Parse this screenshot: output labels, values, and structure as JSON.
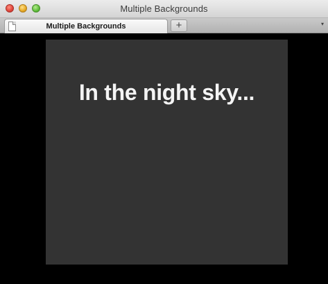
{
  "window": {
    "title": "Multiple Backgrounds"
  },
  "tabs": [
    {
      "label": "Multiple Backgrounds",
      "active": true
    }
  ],
  "toolbar": {
    "new_tab_label": "+",
    "tab_menu_label": "▾"
  },
  "page": {
    "heading": "In the night sky...",
    "box_color": "#333333",
    "background_color": "#000000"
  }
}
